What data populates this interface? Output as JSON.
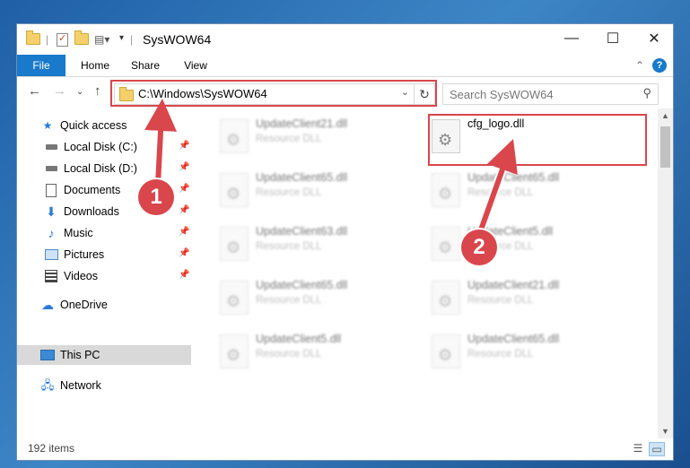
{
  "window": {
    "title": "SysWOW64",
    "minimize_glyph": "—",
    "maximize_glyph": "☐",
    "close_glyph": "✕"
  },
  "ribbon": {
    "tabs": [
      "File",
      "Home",
      "Share",
      "View"
    ],
    "collapse_glyph": "⌃",
    "help_glyph": "?"
  },
  "address": {
    "path": "C:\\Windows\\SysWOW64",
    "search_placeholder": "Search SysWOW64"
  },
  "navigation": {
    "quick_access": "Quick access",
    "items": [
      {
        "label": "Local Disk (C:)",
        "icon": "drive-icon",
        "pinned": true
      },
      {
        "label": "Local Disk (D:)",
        "icon": "drive-icon",
        "pinned": true
      },
      {
        "label": "Documents",
        "icon": "documents-icon",
        "pinned": true
      },
      {
        "label": "Downloads",
        "icon": "downloads-icon",
        "pinned": true
      },
      {
        "label": "Music",
        "icon": "music-icon",
        "pinned": true
      },
      {
        "label": "Pictures",
        "icon": "pictures-icon",
        "pinned": true
      },
      {
        "label": "Videos",
        "icon": "videos-icon",
        "pinned": true
      }
    ],
    "onedrive": "OneDrive",
    "this_pc": "This PC",
    "network": "Network"
  },
  "files": {
    "left_column": [
      {
        "name": "UpdateClient21.dll",
        "type": "Resource DLL"
      },
      {
        "name": "UpdateClient65.dll",
        "type": "Resource DLL"
      },
      {
        "name": "UpdateClient63.dll",
        "type": "Resource DLL"
      },
      {
        "name": "UpdateClient65.dll",
        "type": "Resource DLL"
      },
      {
        "name": "UpdateClient5.dll",
        "type": "Resource DLL"
      }
    ],
    "right_column": [
      {
        "name": "cfg_logo.dll",
        "type": ""
      },
      {
        "name": "UpdateClient65.dll",
        "type": "Resource DLL"
      },
      {
        "name": "UpdateClient5.dll",
        "type": "Resource DLL"
      },
      {
        "name": "UpdateClient21.dll",
        "type": "Resource DLL"
      },
      {
        "name": "UpdateClient65.dll",
        "type": "Resource DLL"
      }
    ]
  },
  "status": {
    "item_count": "192 items"
  },
  "annotations": {
    "step1": "1",
    "step2": "2",
    "accent_color": "#d9464c"
  }
}
